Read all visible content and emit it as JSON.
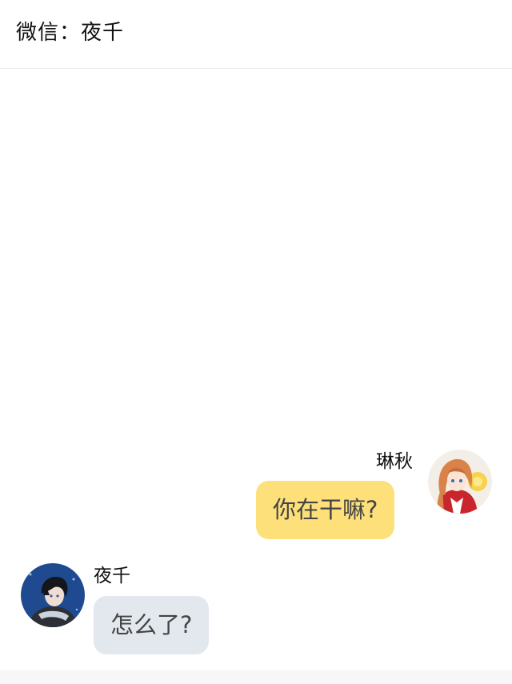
{
  "header": {
    "title": "微信：夜千"
  },
  "messages": [
    {
      "side": "right",
      "sender": "琳秋",
      "text": "你在干嘛?",
      "avatar_icon": "girl-avatar-icon",
      "bubble_color": "#fde07a"
    },
    {
      "side": "left",
      "sender": "夜千",
      "text": "怎么了?",
      "avatar_icon": "boy-avatar-icon",
      "bubble_color": "#e3e8ef"
    }
  ]
}
